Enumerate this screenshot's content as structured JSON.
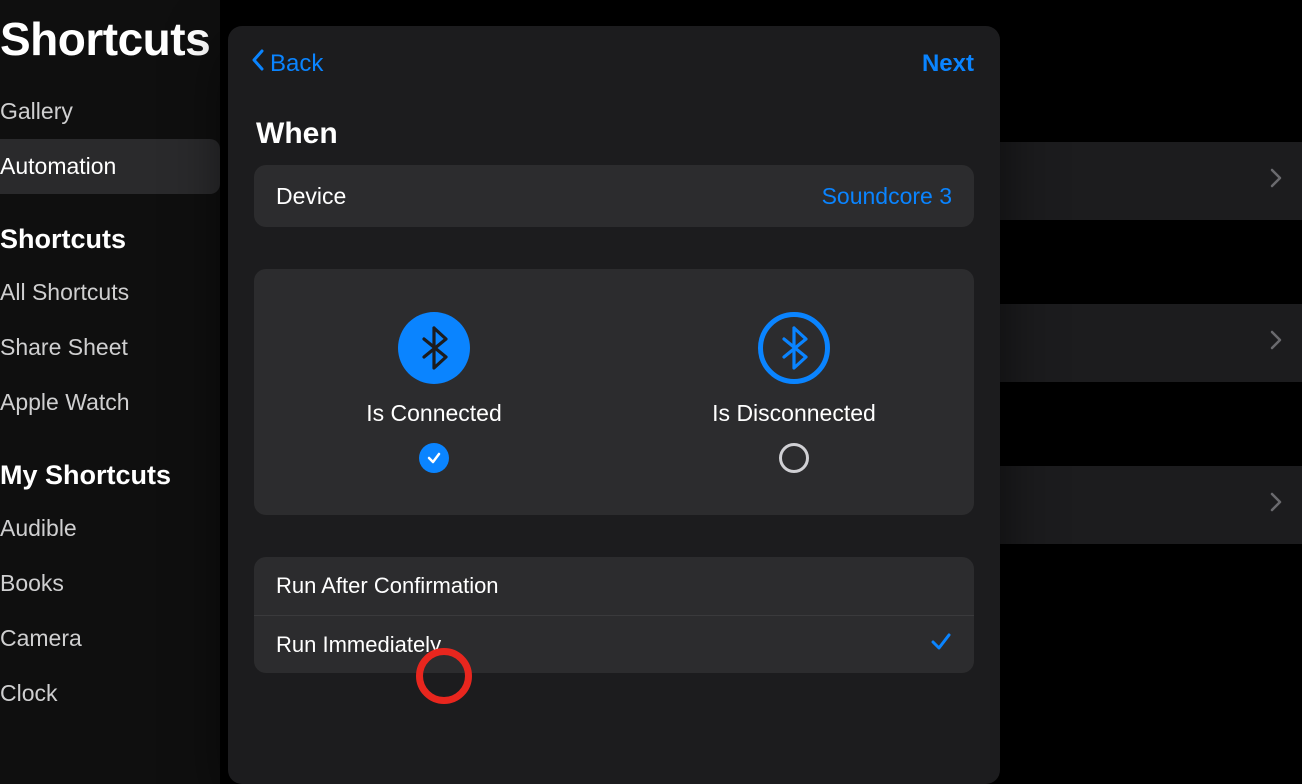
{
  "sidebar": {
    "title": "Shortcuts",
    "items": [
      {
        "label": "Gallery"
      },
      {
        "label": "Automation"
      }
    ],
    "section1_title": "Shortcuts",
    "section1_items": [
      {
        "label": "All Shortcuts"
      },
      {
        "label": "Share Sheet"
      },
      {
        "label": "Apple Watch"
      }
    ],
    "section2_title": "My Shortcuts",
    "section2_items": [
      {
        "label": "Audible"
      },
      {
        "label": "Books"
      },
      {
        "label": "Camera"
      },
      {
        "label": "Clock"
      }
    ]
  },
  "modal": {
    "back_label": "Back",
    "next_label": "Next",
    "when_title": "When",
    "device_label": "Device",
    "device_value": "Soundcore 3",
    "option_connected": "Is Connected",
    "option_disconnected": "Is Disconnected",
    "run_after_confirmation": "Run After Confirmation",
    "run_immediately": "Run Immediately"
  },
  "icons": {
    "bluetooth": "bluetooth-icon",
    "chevron_left": "chevron-left-icon",
    "chevron_right": "chevron-right-icon",
    "checkmark": "checkmark-icon"
  }
}
